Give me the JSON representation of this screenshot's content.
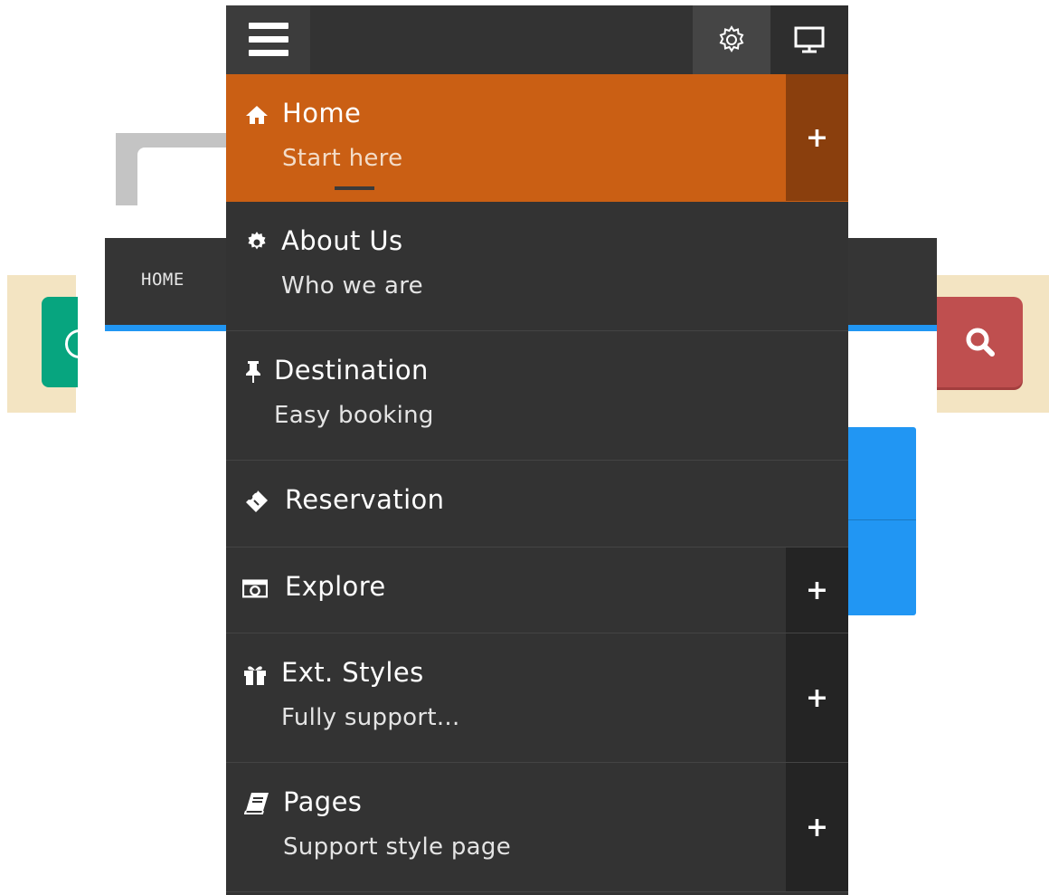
{
  "navbar": {
    "home_link": "HOME"
  },
  "menu": {
    "items": [
      {
        "title": "Home",
        "subtitle": "Start here",
        "icon": "home-icon",
        "expandable": true,
        "active": true
      },
      {
        "title": "About Us",
        "subtitle": "Who we are",
        "icon": "gear-icon",
        "expandable": false,
        "active": false
      },
      {
        "title": "Destination",
        "subtitle": "Easy booking",
        "icon": "pin-icon",
        "expandable": false,
        "active": false
      },
      {
        "title": "Reservation",
        "subtitle": "",
        "icon": "ticket-icon",
        "expandable": false,
        "active": false
      },
      {
        "title": "Explore",
        "subtitle": "",
        "icon": "camera-icon",
        "expandable": true,
        "active": false
      },
      {
        "title": "Ext. Styles",
        "subtitle": "Fully support...",
        "icon": "gift-icon",
        "expandable": true,
        "active": false
      },
      {
        "title": "Pages",
        "subtitle": "Support style page",
        "icon": "book-icon",
        "expandable": true,
        "active": false
      }
    ],
    "expand_symbol": "+"
  },
  "colors": {
    "active_item": "#ca5f14",
    "panel_bg": "#333333",
    "navbar_accent": "#2196f3",
    "search_button": "#bf4f4f",
    "green_button": "#07a57f",
    "band": "#f3e4c2"
  }
}
